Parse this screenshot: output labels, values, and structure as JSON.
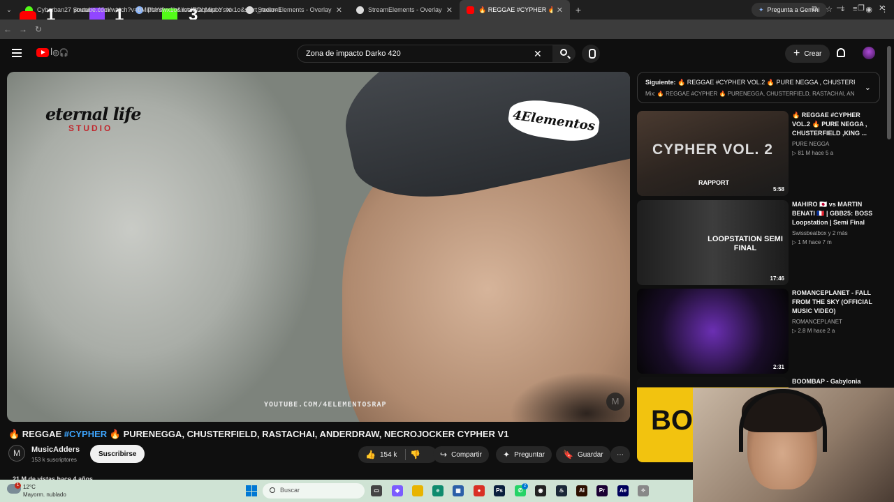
{
  "browser": {
    "tabs": [
      {
        "label": "Cyberban27 Stream - Kick Dash",
        "active": false
      },
      {
        "label": "Planificador realista para crear",
        "active": false
      },
      {
        "label": "StreamElements - Overlays",
        "active": false
      },
      {
        "label": "StreamElements - Overlays",
        "active": false
      },
      {
        "label": "🔥 REGGAE #CYPHER 🔥 PURENEGGA",
        "active": true
      }
    ],
    "gemini_label": "Pregunta a Gemini",
    "url": "youtube.com/watch?v=bMipbYswx1o&list=RDbMipbYswx1o&start_radio=1",
    "overlay_counts": [
      "1",
      "1",
      "3"
    ]
  },
  "youtube": {
    "search_value": "Zona de impacto Darko 420",
    "create_label": "Crear"
  },
  "player": {
    "watermark_left": "eternal life",
    "watermark_left_sub": "STUDIO",
    "watermark_right": "4Elementos",
    "watermark_url": "YOUTUBE.COM/4ELEMENTOSRAP"
  },
  "video": {
    "title_prefix": "🔥 REGGAE ",
    "title_tag": "#CYPHER",
    "title_rest": " 🔥  PURENEGGA, CHUSTERFIELD, RASTACHAI, ANDERDRAW, NECROJOCKER CYPHER V1",
    "channel": "MusicAdders",
    "subscribers": "153 k suscriptores",
    "subscribe_label": "Suscribirse",
    "likes": "154 k",
    "share_label": "Compartir",
    "ask_label": "Preguntar",
    "save_label": "Guardar",
    "views": "21 M de vistas  hace 4 años"
  },
  "next_up": {
    "label": "Siguiente:",
    "title": "🔥 REGGAE #CYPHER VOL.2 🔥 PURE NEGGA , CHUSTERFI...",
    "mix": "Mix: 🔥 REGGAE #CYPHER 🔥 PURENEGGA, CHUSTERFIELD, RASTACHAI, ANDER..."
  },
  "recommendations": [
    {
      "title": "🔥 REGGAE #CYPHER VOL.2 🔥 PURE NEGGA , CHUSTERFIELD ,KING ...",
      "channel": "PURE NEGGA",
      "meta": "▷ 81 M  hace 5 a",
      "duration": "5:58",
      "thumb_text": "CYPHER VOL. 2",
      "thumb_sub": "RAPPORT"
    },
    {
      "title": "MAHIRO 🇯🇵 vs MARTIN BENATI 🇫🇷 | GBB25: BOSS Loopstation | Semi Final",
      "channel": "Swissbeatbox",
      "meta2": "y 2 más",
      "meta": "▷ 1 M  hace 7 m",
      "duration": "17:46",
      "thumb_text": "LOOPSTATION SEMI FINAL"
    },
    {
      "title": "ROMANCEPLANET - FALL FROM THE SKY (OFFICIAL MUSIC VIDEO)",
      "channel": "ROMANCEPLANET",
      "meta": "▷ 2.8 M  hace 2 a",
      "duration": "2:31"
    },
    {
      "title": "BOOMBAP - Gabylonia (Video Oficial)",
      "channel": "",
      "meta": "",
      "duration": "",
      "thumb_text": "BOO"
    }
  ],
  "taskbar": {
    "temperature": "12°C",
    "condition": "Mayorm. nublado",
    "weather_badge": "1",
    "search_placeholder": "Buscar",
    "whatsapp_badge": "2",
    "apps": [
      {
        "name": "copilot-icon",
        "color": "#7b5cff",
        "label": "◆"
      },
      {
        "name": "explorer-icon",
        "color": "#e8b400",
        "label": ""
      },
      {
        "name": "edge-icon",
        "color": "#0f8b6e",
        "label": "e"
      },
      {
        "name": "store-icon",
        "color": "#2b5fa8",
        "label": "▦"
      },
      {
        "name": "chrome-icon",
        "color": "#d93025",
        "label": "●"
      },
      {
        "name": "photoshop-icon",
        "color": "#0a1f3d",
        "label": "Ps"
      },
      {
        "name": "whatsapp-icon",
        "color": "#25d366",
        "label": "✆"
      },
      {
        "name": "obs-icon",
        "color": "#222",
        "label": "◉"
      },
      {
        "name": "steam-icon",
        "color": "#1b2838",
        "label": "♨"
      },
      {
        "name": "illustrator-icon",
        "color": "#2d0f00",
        "label": "Ai"
      },
      {
        "name": "premiere-icon",
        "color": "#1a0033",
        "label": "Pr"
      },
      {
        "name": "aftereffects-icon",
        "color": "#00005b",
        "label": "Ae"
      },
      {
        "name": "overflow-icon",
        "color": "#888",
        "label": "✧"
      }
    ]
  }
}
